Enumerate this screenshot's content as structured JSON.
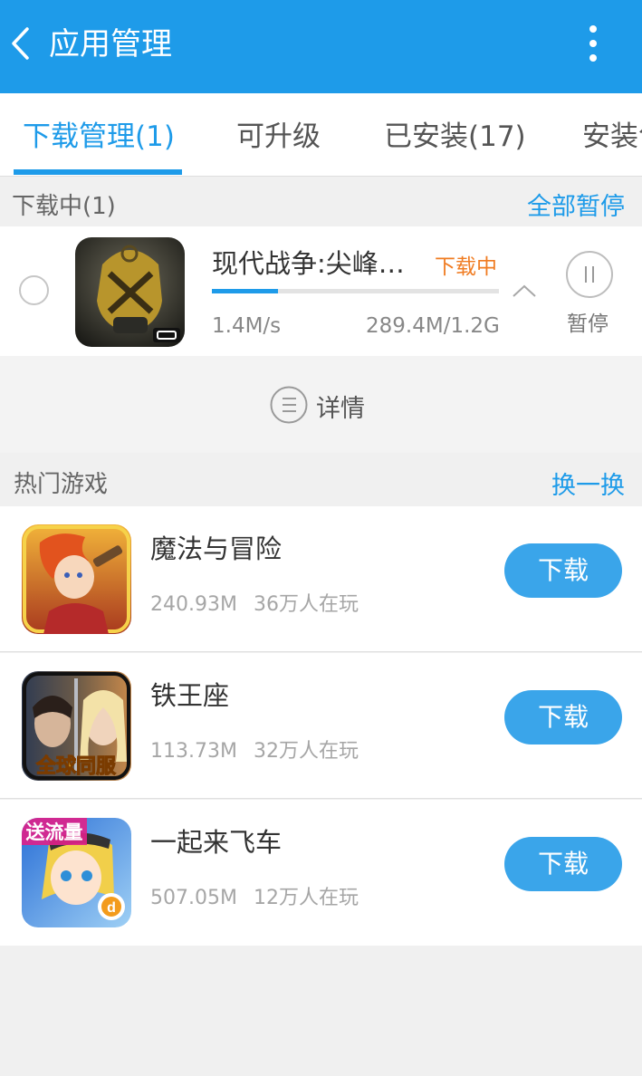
{
  "header": {
    "title": "应用管理",
    "background": "#1e9be9",
    "back_icon": "chevron-left-icon",
    "more_icon": "vertical-dots-icon"
  },
  "tabs": [
    {
      "label": "下载管理(1)",
      "active": true
    },
    {
      "label": "可升级",
      "active": false
    },
    {
      "label": "已安装(17)",
      "active": false
    },
    {
      "label": "安装包",
      "active": false
    }
  ],
  "downloading": {
    "section_title": "下载中(1)",
    "pause_all": "全部暂停",
    "item": {
      "name": "现代战争:尖峰…",
      "status": "下载中",
      "speed": "1.4M/s",
      "size": "289.4M/1.2G",
      "progress_percent": 23,
      "pause_label": "暂停",
      "status_color": "#f07c22"
    },
    "detail_label": "详情"
  },
  "hot_games": {
    "section_title": "热门游戏",
    "refresh": "换一换",
    "download_label": "下载",
    "items": [
      {
        "name": "魔法与冒险",
        "size": "240.93M",
        "players": "36万人在玩"
      },
      {
        "name": "铁王座",
        "size": "113.73M",
        "players": "32万人在玩",
        "icon_text": "全球同服"
      },
      {
        "name": "一起来飞车",
        "size": "507.05M",
        "players": "12万人在玩",
        "icon_text": "送流量"
      }
    ]
  },
  "colors": {
    "accent": "#1e9be9",
    "button": "#3aa5ea",
    "background": "#f0f0f0"
  }
}
